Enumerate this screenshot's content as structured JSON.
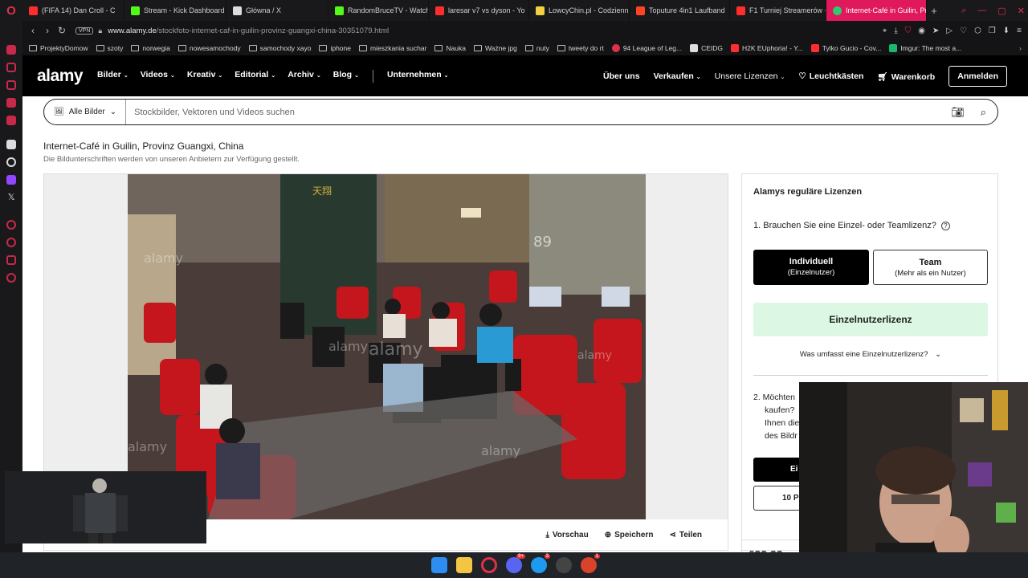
{
  "browser": {
    "tabs": [
      {
        "label": "(FIFA 14) Dan Croll - C",
        "icon_color": "#ff2d2d"
      },
      {
        "label": "Stream - Kick Dashboard",
        "icon_color": "#53fc18"
      },
      {
        "label": "Główna / X",
        "icon_color": "#ffffff"
      },
      {
        "label": "RandomBruceTV - Watch",
        "icon_color": "#53fc18"
      },
      {
        "label": "laresar v7 vs dyson - Yo",
        "icon_color": "#ff2d2d"
      },
      {
        "label": "LowcyChin.pl - Codzienn",
        "icon_color": "#f4d03f"
      },
      {
        "label": "Toputure 4in1 Laufband",
        "icon_color": "#ff4422"
      },
      {
        "label": "F1 Turniej Streamerów -",
        "icon_color": "#ff2d2d"
      },
      {
        "label": "Internet-Café in Guilin, Pr",
        "icon_color": "#2ecc71",
        "active": true
      }
    ],
    "vpn_label": "VPN",
    "url_domain": "www.alamy.de",
    "url_path": "/stockfoto-internet-caf-in-guilin-provinz-guangxi-china-30351079.html",
    "bookmarks": [
      "ProjektyDomow",
      "szoty",
      "norwegia",
      "nowesamochody",
      "samochody xayo",
      "iphone",
      "mieszkania suchar",
      "Nauka",
      "Ważne jpg",
      "nuty",
      "tweety do rt",
      "94 League of Leg...",
      "CEIDG",
      "H2K EUphoria! - Y...",
      "Tylko Gucio - Cov...",
      "Imgur: The most a..."
    ]
  },
  "site": {
    "logo": "alamy",
    "nav": [
      "Bilder",
      "Videos",
      "Kreativ",
      "Editorial",
      "Archiv",
      "Blog"
    ],
    "nav_business": "Unternehmen",
    "right_nav": {
      "about": "Über uns",
      "sell": "Verkaufen",
      "licenses": "Unsere Lizenzen",
      "lightbox": "Leuchtkästen",
      "cart": "Warenkorb",
      "login": "Anmelden"
    },
    "search": {
      "type": "Alle Bilder",
      "placeholder": "Stockbilder, Vektoren und Videos suchen"
    }
  },
  "image": {
    "title": "Internet-Café in Guilin, Provinz Guangxi, China",
    "caption_note": "Die Bildunterschriften werden von unseren Anbietern zur Verfügung gestellt.",
    "actions": {
      "preview": "Vorschau",
      "save": "Speichern",
      "share": "Teilen"
    },
    "watermark": "alamy",
    "sign_number": "89"
  },
  "license": {
    "heading": "Alamys reguläre Lizenzen",
    "q1": "1.  Brauchen Sie eine Einzel- oder Teamlizenz?",
    "individual_label": "Individuell",
    "individual_sub": "(Einzelnutzer)",
    "team_label": "Team",
    "team_sub": "(Mehr als ein Nutzer)",
    "selected": "Einzelnutzerlizenz",
    "more_info": "Was umfasst eine Einzelnutzerlizenz?",
    "q2_lines": [
      "2.  Möchten",
      "kaufen?",
      "Ihnen die",
      "des Bildr"
    ],
    "btn_black_partial": "Ei",
    "btn_outline_partial": "10 P",
    "price_partial": "£??,??"
  }
}
